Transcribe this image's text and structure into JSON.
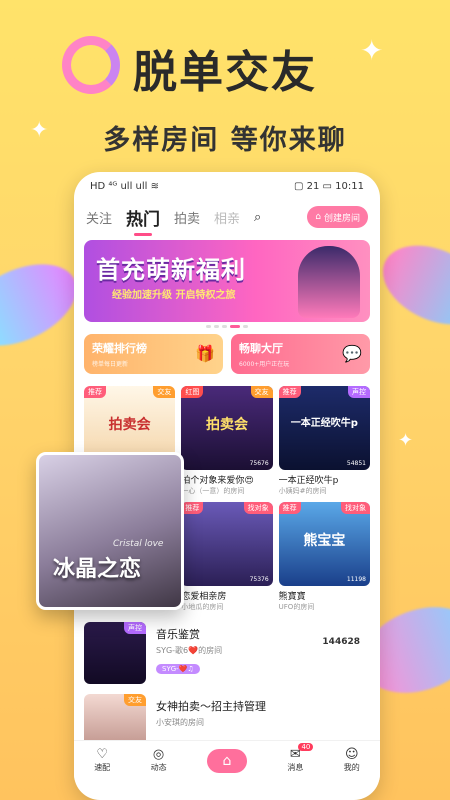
{
  "promo": {
    "headline": "脱单交友",
    "subhead": "多样房间  等你来聊"
  },
  "statusbar": {
    "left": "HD ⁴ᴳ ull ull ≋",
    "right": "▢ 21 ▭ 10:11"
  },
  "tabs": [
    "关注",
    "热门",
    "拍卖",
    "相亲"
  ],
  "create_room": "创建房间",
  "banner": {
    "title": "首充萌新福利",
    "sub": "经验加速升级 开启特权之旅"
  },
  "quick": [
    {
      "title": "荣耀排行榜",
      "sub": "榜单每日更新"
    },
    {
      "title": "畅聊大厅",
      "sub": "6000+用户正在玩"
    }
  ],
  "rooms": [
    {
      "tagL": "推荐",
      "tagR": "交友",
      "cover": "拍卖会",
      "name": "",
      "owner": "",
      "count": ""
    },
    {
      "tagL": "红图",
      "tagR": "交友",
      "cover": "拍卖会",
      "name": "拍个对象来爱你😍",
      "owner": "一心（一意）的房间",
      "count": "75676"
    },
    {
      "tagL": "推荐",
      "tagR": "声控",
      "cover": "一本正经吹牛p",
      "name": "一本正经吹牛p",
      "owner": "小姨妈#的房间",
      "count": "54851"
    },
    {
      "tagL": "",
      "tagR": "",
      "cover": "",
      "name": "",
      "owner": "",
      "count": ""
    },
    {
      "tagL": "推荐",
      "tagR": "找对象",
      "cover": "",
      "name": "恋爱相亲房",
      "owner": "小地瓜的房间",
      "count": "75376"
    },
    {
      "tagL": "推荐",
      "tagR": "找对象",
      "cover": "熊宝宝",
      "name": "熊寶寶",
      "owner": "UFO的房间",
      "count": "11198"
    }
  ],
  "list": [
    {
      "tag": "声控",
      "title": "音乐鉴赏",
      "sub": "SYG-歌6❤️的房间",
      "badge": "SYG-❤️♫",
      "count": "144628"
    },
    {
      "tag": "交友",
      "title": "女神拍卖～招主持管理",
      "sub": "小安琪的房间",
      "badge": "",
      "count": ""
    }
  ],
  "float_card": {
    "title": "冰晶之恋",
    "sub": "Cristal love"
  },
  "nav": [
    {
      "label": "速配",
      "icon": "heart-icon"
    },
    {
      "label": "动态",
      "icon": "compass-icon"
    },
    {
      "label": "",
      "icon": "home-icon"
    },
    {
      "label": "消息",
      "icon": "message-icon",
      "badge": "40"
    },
    {
      "label": "我的",
      "icon": "profile-icon"
    }
  ]
}
